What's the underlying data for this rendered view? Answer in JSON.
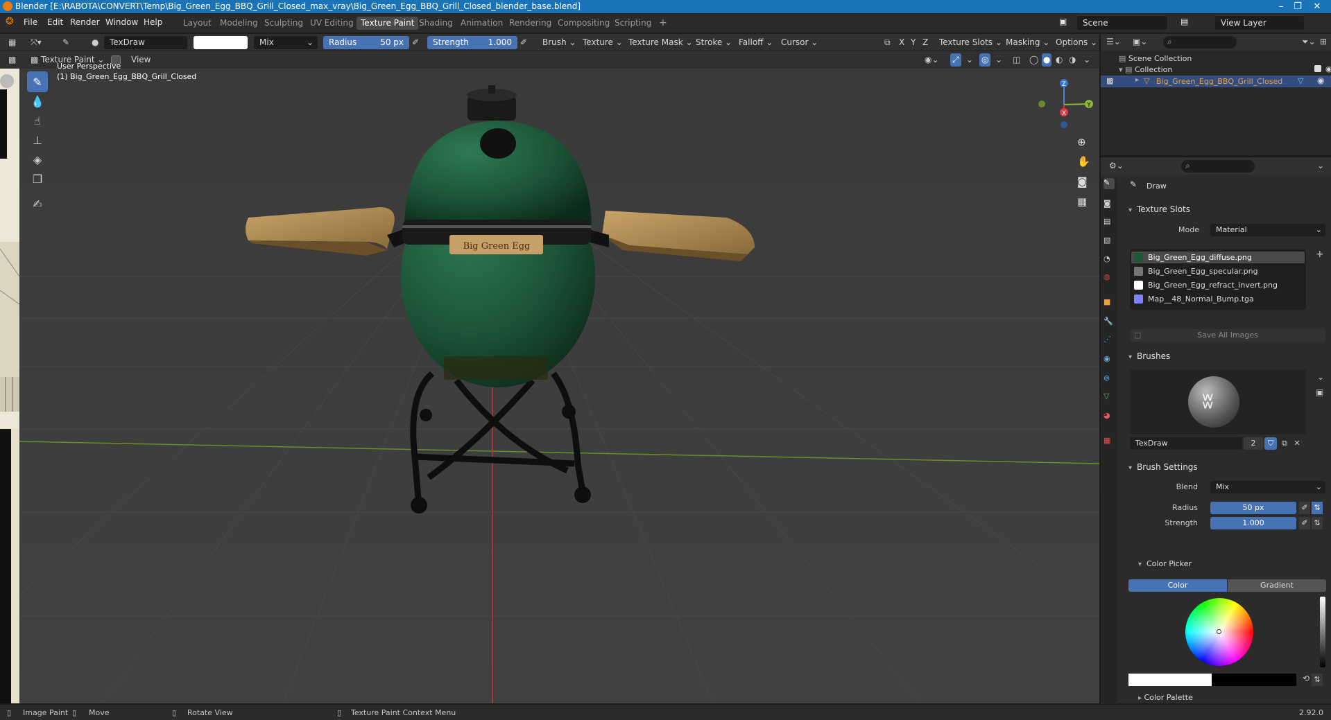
{
  "window": {
    "title": "Blender [E:\\RABOTA\\CONVERT\\Temp\\Big_Green_Egg_BBQ_Grill_Closed_max_vray\\Big_Green_Egg_BBQ_Grill_Closed_blender_base.blend]",
    "controls": [
      "–",
      "❐",
      "✕"
    ]
  },
  "menu": [
    "File",
    "Edit",
    "Render",
    "Window",
    "Help"
  ],
  "workspaces": [
    "Layout",
    "Modeling",
    "Sculpting",
    "UV Editing",
    "Texture Paint",
    "Shading",
    "Animation",
    "Rendering",
    "Compositing",
    "Scripting"
  ],
  "active_workspace": "Texture Paint",
  "add_workspace": "+",
  "scene": {
    "label": "Scene",
    "view_layer": "View Layer"
  },
  "tool_header": {
    "brush_name": "TexDraw",
    "blend": "Mix",
    "radius_label": "Radius",
    "radius_value": "50 px",
    "strength_label": "Strength",
    "strength_value": "1.000",
    "menus": [
      "Brush",
      "Texture",
      "Texture Mask",
      "Stroke",
      "Falloff",
      "Cursor"
    ],
    "axes": [
      "X",
      "Y",
      "Z"
    ],
    "right_menus": [
      "Texture Slots",
      "Masking",
      "Options"
    ]
  },
  "view_header": {
    "mode": "Texture Paint",
    "view": "View"
  },
  "viewport": {
    "perspective": "User Perspective",
    "object_label": "(1) Big_Green_Egg_BBQ_Grill_Closed",
    "plate_text": "Big Green Egg",
    "gizmo": {
      "x": "X",
      "y": "Y",
      "z": "Z"
    }
  },
  "tools": [
    "draw",
    "soften",
    "smear",
    "clone",
    "fill",
    "mask",
    "annotate"
  ],
  "outliner": {
    "scene_collection": "Scene Collection",
    "collection": "Collection",
    "object": "Big_Green_Egg_BBQ_Grill_Closed"
  },
  "properties": {
    "tool_name": "Draw",
    "texture_slots": {
      "header": "Texture Slots",
      "mode_label": "Mode",
      "mode_value": "Material",
      "slots": [
        "Big_Green_Egg_diffuse.png",
        "Big_Green_Egg_specular.png",
        "Big_Green_Egg_refract_invert.png",
        "Map__48_Normal_Bump.tga"
      ],
      "save_all": "Save All Images"
    },
    "brushes": {
      "header": "Brushes",
      "brush_name": "TexDraw",
      "users": "2"
    },
    "brush_settings": {
      "header": "Brush Settings",
      "blend_label": "Blend",
      "blend_value": "Mix",
      "radius_label": "Radius",
      "radius_value": "50 px",
      "strength_label": "Strength",
      "strength_value": "1.000"
    },
    "color_picker": {
      "header": "Color Picker",
      "tab_color": "Color",
      "tab_gradient": "Gradient"
    },
    "color_palette": "Color Palette"
  },
  "statusbar": {
    "left": "Image Paint",
    "move": "Move",
    "rotate": "Rotate View",
    "context": "Texture Paint Context Menu",
    "version": "2.92.0"
  },
  "colors": {
    "accent": "#4772b3",
    "title_bar": "#1a73b7",
    "egg_green": "#1e5a3a",
    "selected_object": "#e8a042"
  }
}
